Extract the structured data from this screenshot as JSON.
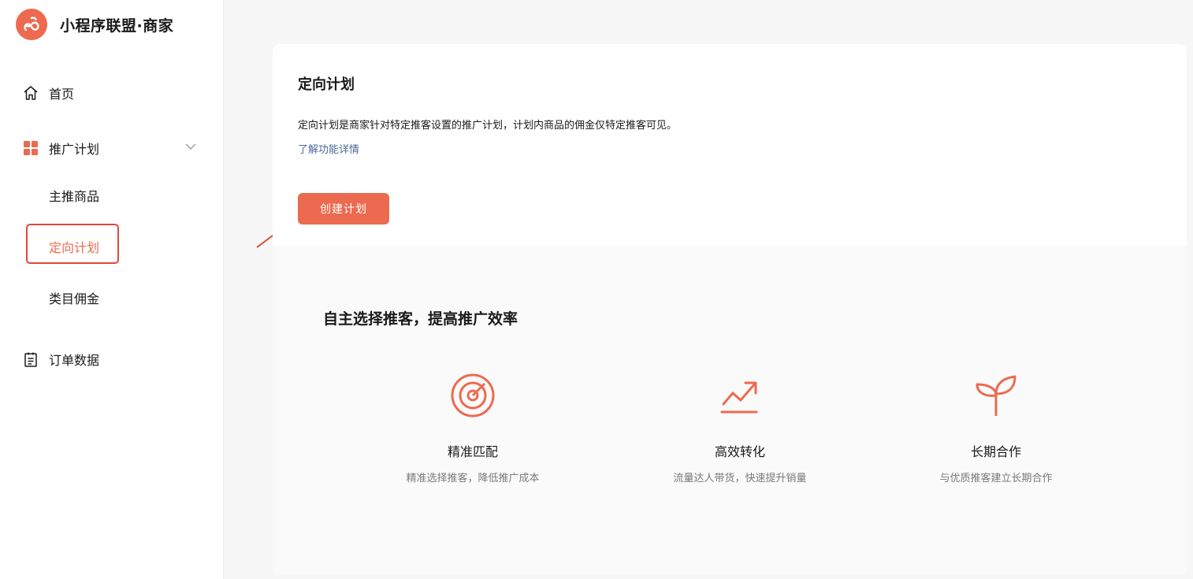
{
  "brand": {
    "name": "小程序联盟·商家",
    "logo_icon": "mini-program-icon",
    "accent": "#ec6a50"
  },
  "sidebar": {
    "home": {
      "label": "首页",
      "icon": "home-icon"
    },
    "promotion_plan": {
      "label": "推广计划",
      "icon": "grid-icon",
      "expanded": true,
      "items": [
        {
          "label": "主推商品"
        },
        {
          "label": "定向计划",
          "active": true
        },
        {
          "label": "类目佣金"
        }
      ]
    },
    "orders": {
      "label": "订单数据",
      "icon": "clipboard-icon"
    }
  },
  "main": {
    "title": "定向计划",
    "description": "定向计划是商家针对特定推客设置的推广计划，计划内商品的佣金仅特定推客可见。",
    "learn_more": "了解功能详情",
    "create_button": "创建计划",
    "feature_heading": "自主选择推客，提高推广效率",
    "features": [
      {
        "name": "精准匹配",
        "desc": "精准选择推客，降低推广成本",
        "icon": "target-icon"
      },
      {
        "name": "高效转化",
        "desc": "流量达人带货，快速提升销量",
        "icon": "trend-up-icon"
      },
      {
        "name": "长期合作",
        "desc": "与优质推客建立长期合作",
        "icon": "sprout-icon"
      }
    ]
  },
  "colors": {
    "accent": "#ec6a50",
    "link": "#4a6a9a",
    "annotation": "#e0473a"
  }
}
